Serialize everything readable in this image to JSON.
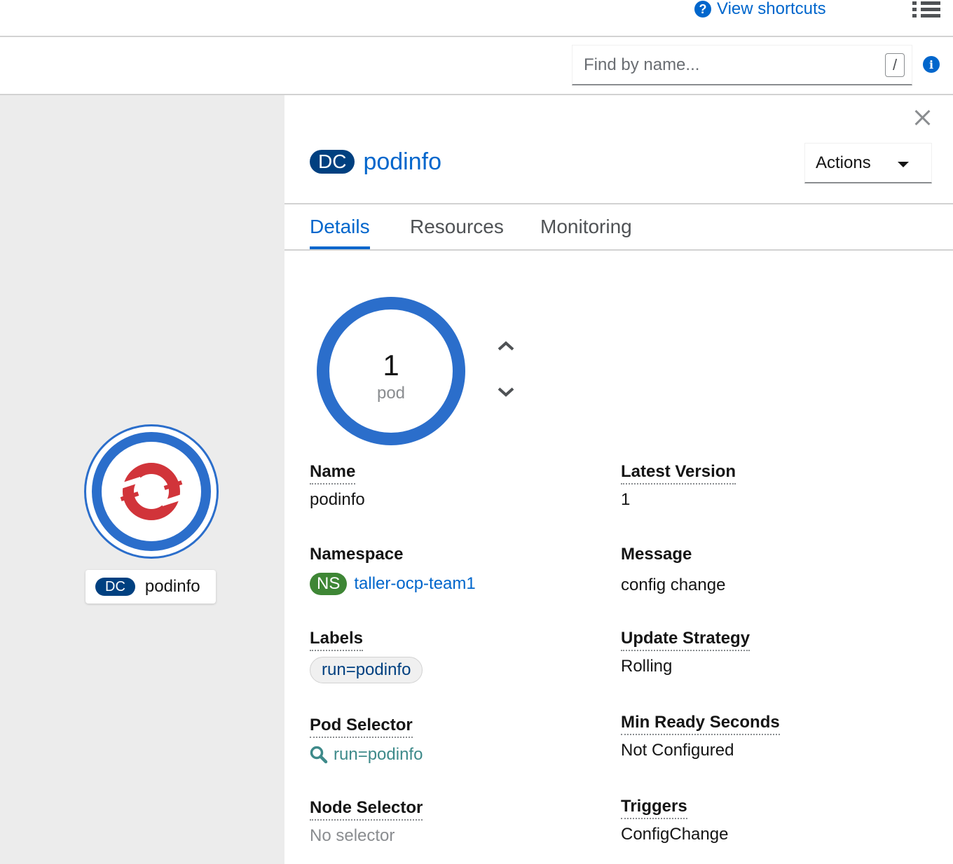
{
  "header": {
    "shortcuts_label": "View shortcuts",
    "question_icon": "question-circle-icon",
    "menu_icon": "list-view-icon"
  },
  "filter": {
    "placeholder": "Find by name...",
    "slash_hint": "/",
    "info_icon": "i"
  },
  "topology": {
    "node_kind": "DC",
    "node_name": "podinfo",
    "node_icon": "openshift-logo"
  },
  "panel": {
    "kind_badge": "DC",
    "title": "podinfo",
    "actions_label": "Actions",
    "tabs": [
      {
        "label": "Details",
        "active": true
      },
      {
        "label": "Resources",
        "active": false
      },
      {
        "label": "Monitoring",
        "active": false
      }
    ],
    "pod_count": "1",
    "pod_unit": "pod",
    "details": {
      "name": {
        "label": "Name",
        "value": "podinfo"
      },
      "namespace": {
        "label": "Namespace",
        "badge": "NS",
        "value": "taller-ocp-team1"
      },
      "labels": {
        "label": "Labels",
        "chip": "run=podinfo"
      },
      "pod_selector": {
        "label": "Pod Selector",
        "value": "run=podinfo"
      },
      "node_selector": {
        "label": "Node Selector",
        "value": "No selector"
      },
      "latest_version": {
        "label": "Latest Version",
        "value": "1"
      },
      "message": {
        "label": "Message",
        "value": "config change"
      },
      "update_strategy": {
        "label": "Update Strategy",
        "value": "Rolling"
      },
      "min_ready": {
        "label": "Min Ready Seconds",
        "value": "Not Configured"
      },
      "triggers": {
        "label": "Triggers",
        "value": "ConfigChange"
      }
    }
  },
  "colors": {
    "link": "#0066cc",
    "badge_dc": "#004080",
    "badge_ns": "#3e8635",
    "ring": "#2b6ecb",
    "canvas_bg": "#ececec",
    "logo_red": "#d1343a"
  }
}
